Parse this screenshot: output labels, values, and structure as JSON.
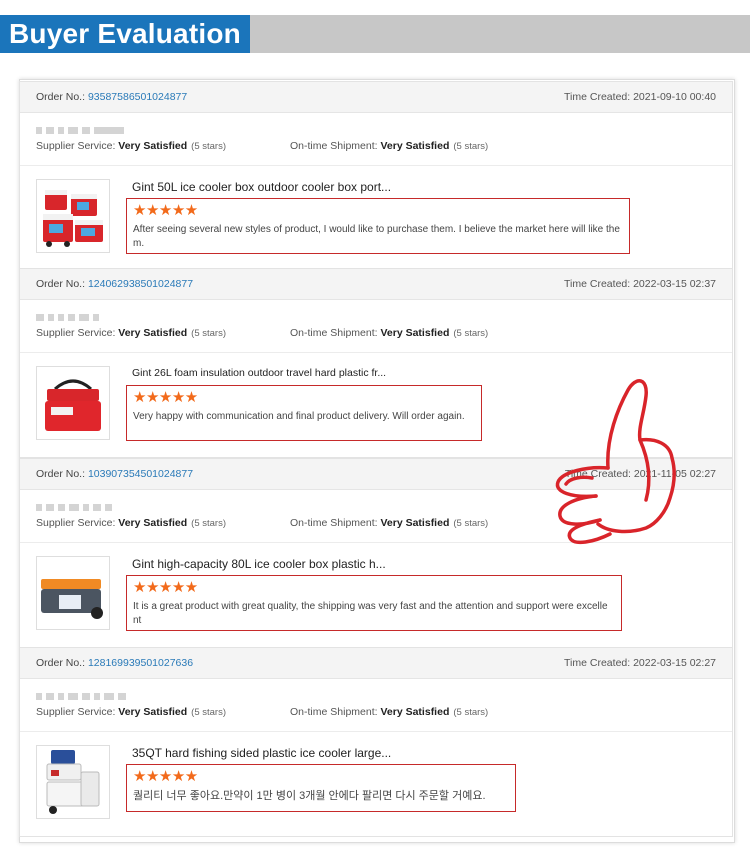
{
  "banner": {
    "title": "Buyer Evaluation"
  },
  "labels": {
    "order_no": "Order No.:",
    "time_created": "Time Created:",
    "supplier_service": "Supplier Service:",
    "ontime_shipment": "On-time Shipment:"
  },
  "reviews": [
    {
      "order_no": "93587586501024877",
      "time": "2021-09-10 00:40",
      "supplier_service": "Very Satisfied",
      "supplier_stars": "(5 stars)",
      "shipment": "Very Satisfied",
      "shipment_stars": "(5 stars)",
      "product_title": "Gint 50L ice cooler box outdoor cooler box port...",
      "rating_stars": "★★★★★",
      "text": "After seeing several new styles of product, I would like to purchase them. I believe the market here will like them."
    },
    {
      "order_no": "124062938501024877",
      "time": "2022-03-15 02:37",
      "supplier_service": "Very Satisfied",
      "supplier_stars": "(5 stars)",
      "shipment": "Very Satisfied",
      "shipment_stars": "(5 stars)",
      "product_title": "Gint 26L foam insulation outdoor travel hard plastic fr...",
      "rating_stars": "★★★★★",
      "text": "Very happy with communication and final product delivery. Will order again."
    },
    {
      "order_no": "103907354501024877",
      "time": "2021-11-05 02:27",
      "supplier_service": "Very Satisfied",
      "supplier_stars": "(5 stars)",
      "shipment": "Very Satisfied",
      "shipment_stars": "(5 stars)",
      "product_title": "Gint high-capacity 80L ice cooler box plastic h...",
      "rating_stars": "★★★★★",
      "text": "It is a great product with great quality, the shipping was very fast and the attention and support were excellent"
    },
    {
      "order_no": "128169939501027636",
      "time": "2022-03-15 02:27",
      "supplier_service": "Very Satisfied",
      "supplier_stars": "(5 stars)",
      "shipment": "Very Satisfied",
      "shipment_stars": "(5 stars)",
      "product_title": "35QT hard fishing sided plastic ice cooler large...",
      "rating_stars": "★★★★★",
      "text": "퀄리티 너무 좋아요.만약이 1만 병이 3개월 안에다 팔리면 다시 주문할 거예요."
    }
  ],
  "colors": {
    "banner_blue": "#1b75bb",
    "banner_gray": "#c7c7c7",
    "link_blue": "#2a7ab8",
    "highlight_red": "#c62a2a",
    "star_orange": "#f26a1b"
  },
  "icons": [
    "thumbs-up-drawing-icon",
    "cooler-product-image"
  ]
}
